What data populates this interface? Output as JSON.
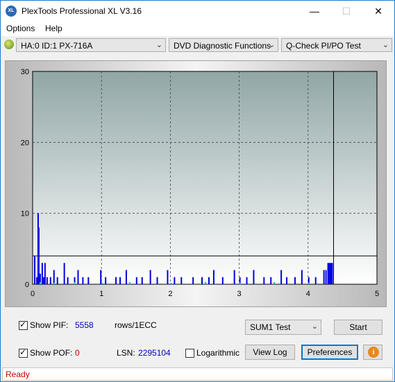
{
  "window": {
    "title": "PlexTools Professional XL V3.16",
    "icon_text": "XL",
    "minimize": "—",
    "maximize": "☐",
    "close": "✕"
  },
  "menu": {
    "items": [
      "Options",
      "Help"
    ]
  },
  "toolbar": {
    "drive": "HA:0 ID:1  PX-716A",
    "function": "DVD Diagnostic Functions",
    "test": "Q-Check PI/PO Test",
    "arrow": "⌄"
  },
  "chart_data": {
    "type": "bar",
    "xlim": [
      0,
      5
    ],
    "ylim": [
      0,
      30
    ],
    "x_ticks": [
      "0",
      "1",
      "2",
      "3",
      "4",
      "5"
    ],
    "y_ticks": [
      "0",
      "10",
      "20",
      "30"
    ],
    "grid": true,
    "threshold": 4,
    "end_marker": 4.37,
    "series": [
      {
        "color": "#0000e0",
        "points": [
          [
            0.02,
            4
          ],
          [
            0.05,
            1
          ],
          [
            0.07,
            10
          ],
          [
            0.08,
            8
          ],
          [
            0.1,
            1.5
          ],
          [
            0.13,
            3
          ],
          [
            0.15,
            1
          ],
          [
            0.17,
            3
          ],
          [
            0.2,
            1
          ],
          [
            0.25,
            1
          ],
          [
            0.3,
            2
          ],
          [
            0.35,
            1
          ],
          [
            0.45,
            3
          ],
          [
            0.5,
            1
          ],
          [
            0.6,
            1
          ],
          [
            0.65,
            2
          ],
          [
            0.72,
            1
          ],
          [
            0.8,
            1
          ],
          [
            0.98,
            2
          ],
          [
            1.05,
            1
          ],
          [
            1.2,
            1
          ],
          [
            1.26,
            1
          ],
          [
            1.35,
            2
          ],
          [
            1.5,
            1
          ],
          [
            1.58,
            1
          ],
          [
            1.7,
            2
          ],
          [
            1.8,
            1
          ],
          [
            1.95,
            2
          ],
          [
            2.05,
            1
          ],
          [
            2.15,
            1
          ],
          [
            2.32,
            1
          ],
          [
            2.45,
            1
          ],
          [
            2.55,
            1
          ],
          [
            2.62,
            2
          ],
          [
            2.75,
            1
          ],
          [
            2.92,
            2
          ],
          [
            3.0,
            1
          ],
          [
            3.1,
            1
          ],
          [
            3.2,
            2
          ],
          [
            3.35,
            1
          ],
          [
            3.45,
            1
          ],
          [
            3.6,
            2
          ],
          [
            3.68,
            1
          ],
          [
            3.8,
            1
          ],
          [
            3.9,
            2
          ],
          [
            4.0,
            1
          ],
          [
            4.1,
            1
          ],
          [
            4.22,
            2
          ],
          [
            4.25,
            2
          ],
          [
            4.28,
            3
          ],
          [
            4.3,
            3
          ],
          [
            4.32,
            3
          ],
          [
            4.34,
            3
          ]
        ]
      },
      {
        "color": "#00c0c0",
        "points": [
          [
            0.1,
            0.3
          ],
          [
            0.3,
            0.2
          ],
          [
            0.6,
            0.3
          ],
          [
            1.0,
            0.2
          ],
          [
            1.4,
            0.3
          ],
          [
            2.0,
            0.2
          ],
          [
            2.5,
            0.3
          ],
          [
            3.0,
            0.2
          ],
          [
            3.5,
            0.3
          ],
          [
            4.0,
            0.2
          ]
        ]
      }
    ]
  },
  "bottom": {
    "show_pif_label": "Show PIF:",
    "pif_value": "5558",
    "rows_label": "rows/1ECC",
    "show_pof_label": "Show POF:",
    "pof_value": "0",
    "lsn_label": "LSN:",
    "lsn_value": "2295104",
    "log_label": "Logarithmic",
    "sum_select": "SUM1 Test",
    "start": "Start",
    "view_log": "View Log",
    "preferences": "Preferences",
    "info_glyph": "i"
  },
  "status": {
    "text": "Ready"
  }
}
